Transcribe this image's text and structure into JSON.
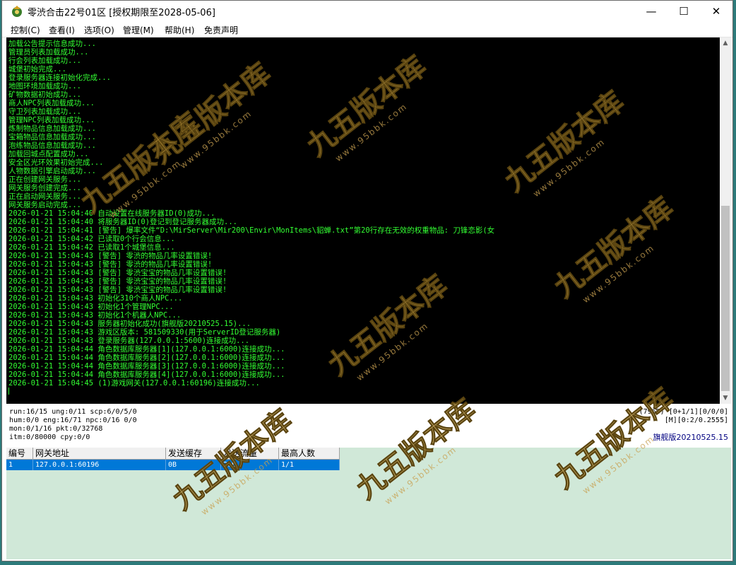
{
  "window": {
    "title": "零渋合击22号01区 [授权期限至2028-05-06]",
    "minimize_glyph": "—",
    "maximize_glyph": "☐",
    "close_glyph": "✕"
  },
  "menu": [
    {
      "label": "控制(C)"
    },
    {
      "label": "查看(I)"
    },
    {
      "label": "选项(O)"
    },
    {
      "label": "管理(M)"
    },
    {
      "label": "帮助(H)"
    },
    {
      "label": "免责声明"
    }
  ],
  "console": {
    "text_color": "#33ff33",
    "lines": [
      "加载公告提示信息成功...",
      "管理员列表加载成功...",
      "行会列表加载成功...",
      "城堡初始完成...",
      "登录服务器连接初始化完成...",
      "地图环境加载成功...",
      "矿物数据初始成功...",
      "商人NPC列表加载成功...",
      "守卫列表加载成功...",
      "管理NPC列表加载成功...",
      "炼制物品信息加载成功...",
      "宝箱物品信息加载成功...",
      "泡练物品信息加载成功...",
      "加载回城点配置成功...",
      "安全区光环效果初始完成...",
      "人物数据引擎启动成功...",
      "正在创建网关服务...",
      "网关服务创建完成...",
      "正在启动网关服务...",
      "网关服务启动完成...",
      "2026-01-21 15:04:40 自动设置在线服务器ID(0)成功...",
      "2026-01-21 15:04:40 将服务器ID(0)登记到登记服务器成功...",
      "2026-01-21 15:04:41 [警告] 爆率文件“D:\\MirServer\\Mir200\\Envir\\MonItems\\貂蝉.txt”第20行存在无效的权重物品: 刀锋恋影(女",
      "2026-01-21 15:04:42 已读取0个行会信息...",
      "2026-01-21 15:04:42 已读取1个城堡信息...",
      "2026-01-21 15:04:43 [警告] 零渋的物品几率设置错误!",
      "2026-01-21 15:04:43 [警告] 零渋的物品几率设置错误!",
      "2026-01-21 15:04:43 [警告] 零渋宝宝的物品几率设置错误!",
      "2026-01-21 15:04:43 [警告] 零渋宝宝的物品几率设置错误!",
      "2026-01-21 15:04:43 [警告] 零渋宝宝的物品几率设置错误!",
      "2026-01-21 15:04:43 初始化310个商人NPC...",
      "2026-01-21 15:04:43 初始化1个管理NPC...",
      "2026-01-21 15:04:43 初始化1个机器人NPC...",
      "2026-01-21 15:04:43 服务器初始化成功(旗舰版20210525.15)...",
      "2026-01-21 15:04:43 游戏区版本: 581509330(用于ServerID登记服务器)",
      "2026-01-21 15:04:43 登录服务器(127.0.0.1:5600)连接成功...",
      "2026-01-21 15:04:44 角色数据库服务器[1](127.0.0.1:6000)连接成功...",
      "2026-01-21 15:04:44 角色数据库服务器[2](127.0.0.1:6000)连接成功...",
      "2026-01-21 15:04:44 角色数据库服务器[3](127.0.0.1:6000)连接成功...",
      "2026-01-21 15:04:44 角色数据库服务器[4](127.0.0.1:6000)连接成功...",
      "2026-01-21 15:04:45 (1)游戏网关(127.0.0.1:60196)连接成功..."
    ]
  },
  "status": {
    "left": [
      "run:16/15 ung:0/11 scp:6/0/5/0",
      "hum:0/0 eng:16/71 npc:0/16 0/0",
      "mon:0/1/16 pkt:0/32768",
      "itm:0/80000 cpy:0/0"
    ],
    "right": [
      "(7968) [0+1/1][0/0/0]",
      "[M][0:2/0.2555]"
    ],
    "version": "旗舰版20210525.15"
  },
  "gateway_list": {
    "columns": [
      "编号",
      "网关地址",
      "发送缓存",
      "发送流量",
      "最高人数"
    ],
    "rows": [
      [
        "1",
        "127.0.0.1:60196",
        "0B",
        "20B",
        "1/1"
      ]
    ]
  },
  "watermark": {
    "text": "九五版本库",
    "url": "www.95bbk.com"
  }
}
